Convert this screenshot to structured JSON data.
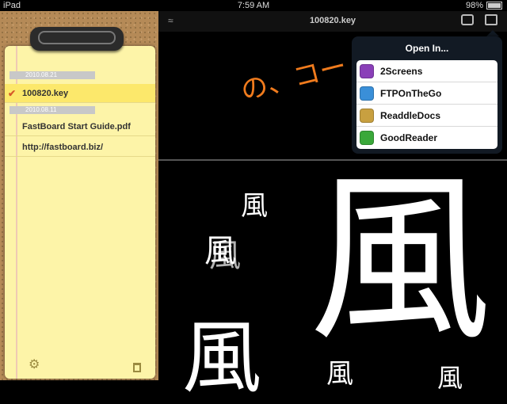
{
  "status": {
    "device": "iPad",
    "time": "7:59 AM",
    "battery": "98%",
    "battery_fraction": 0.98
  },
  "sidebar": {
    "groups": [
      {
        "date": "2010.08.21",
        "items": [
          {
            "label": "100820.key",
            "selected": true
          }
        ]
      },
      {
        "date": "2010.08.11",
        "items": [
          {
            "label": "FastBoard Start Guide.pdf"
          },
          {
            "label": "http://fastboard.biz/"
          }
        ]
      }
    ],
    "icons": [
      "gear-icon",
      "trash-icon"
    ]
  },
  "viewer": {
    "title": "100820.key",
    "slide_top_text": "の、コー",
    "kanji": "風"
  },
  "open_in": {
    "title": "Open In...",
    "apps": [
      {
        "label": "2Screens",
        "icon": "2screens-app-icon",
        "color": "#8a3fb8"
      },
      {
        "label": "FTPOnTheGo",
        "icon": "ftponthego-app-icon",
        "color": "#3a8fd8"
      },
      {
        "label": "ReaddleDocs",
        "icon": "readdledocs-app-icon",
        "color": "#c8a040"
      },
      {
        "label": "GoodReader",
        "icon": "goodreader-app-icon",
        "color": "#3aa83a"
      }
    ]
  },
  "colors": {
    "accent": "#f07b1d",
    "selected_row": "#fce86b",
    "notepad": "#fdf4a8"
  }
}
